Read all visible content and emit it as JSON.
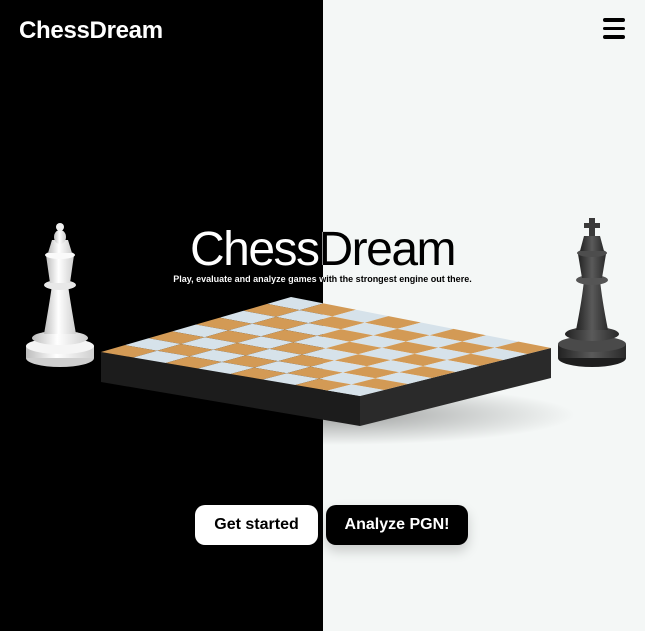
{
  "header": {
    "brand": "ChessDream",
    "menu_icon": "hamburger-menu-icon"
  },
  "hero": {
    "title": "ChessDream",
    "tagline": "Play, evaluate and analyze games with the strongest engine out there."
  },
  "actions": {
    "primary_label": "Get started",
    "secondary_label": "Analyze PGN!"
  },
  "colors": {
    "left_bg": "#000000",
    "right_bg": "#f4f7f6",
    "board_light": "#d6e2ea",
    "board_dark": "#d39a55",
    "board_side": "#1c1c1c",
    "white_piece": "#f2f2f2",
    "black_piece": "#3a3a3a"
  },
  "illustration": {
    "board_size": 8,
    "left_piece": "queen",
    "right_piece": "king"
  }
}
